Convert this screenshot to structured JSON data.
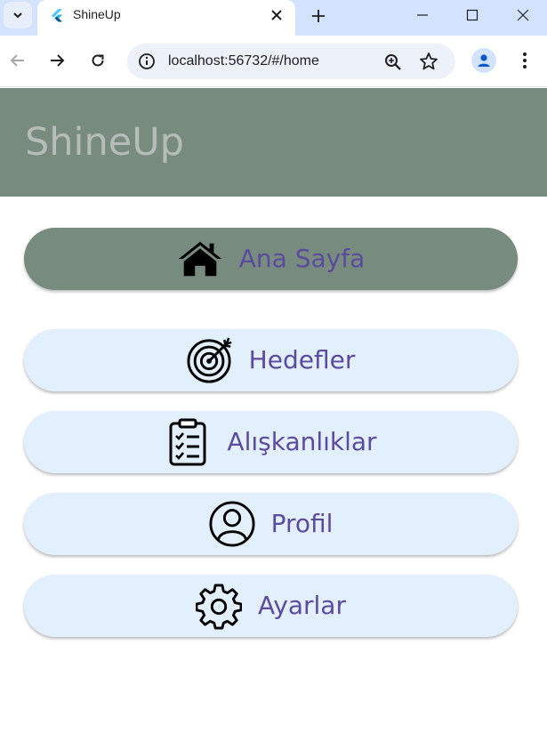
{
  "browser": {
    "tab_title": "ShineUp",
    "url": "localhost:56732/#/home"
  },
  "app": {
    "title": "ShineUp",
    "colors": {
      "appbar": "#778b7e",
      "button_bg": "#e2effc",
      "active_button_bg": "#778b7e",
      "label": "#5c4a9e"
    }
  },
  "menu": {
    "items": [
      {
        "label": "Ana Sayfa",
        "icon": "home-icon",
        "active": true
      },
      {
        "label": "Hedefler",
        "icon": "target-icon",
        "active": false
      },
      {
        "label": "Alışkanlıklar",
        "icon": "clipboard-checklist-icon",
        "active": false
      },
      {
        "label": "Profil",
        "icon": "user-circle-icon",
        "active": false
      },
      {
        "label": "Ayarlar",
        "icon": "gear-icon",
        "active": false
      }
    ]
  }
}
